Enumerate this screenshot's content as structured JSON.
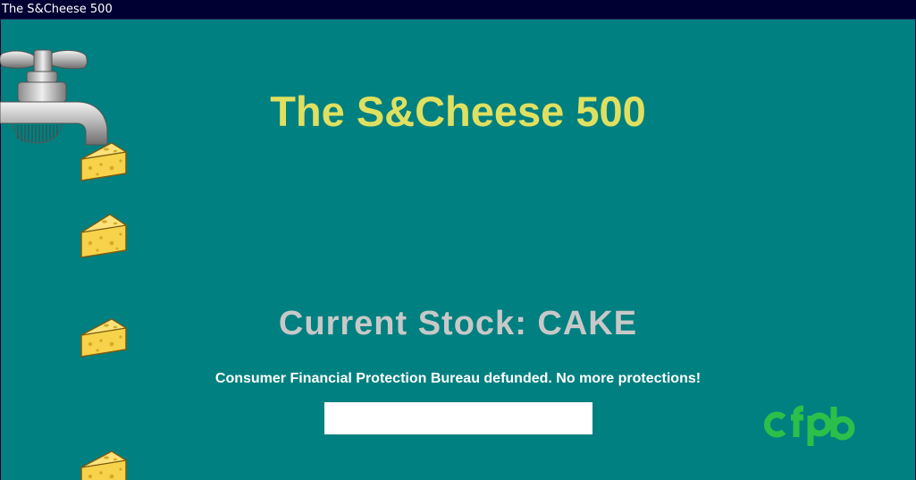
{
  "window": {
    "title": "The S&Cheese 500"
  },
  "game": {
    "title": "The S&Cheese 500",
    "current_stock_label": "Current Stock: CAKE",
    "news_message": "Consumer Financial Protection Bureau defunded. No more protections!",
    "answer_input": {
      "value": "",
      "placeholder": ""
    }
  },
  "logo": {
    "text": "cfpb",
    "color": "#2cbf4a"
  },
  "colors": {
    "background": "#008080",
    "title": "#e0e060",
    "stock": "#c8c8c8",
    "news": "#ffffff",
    "titlebar": "#000032"
  },
  "sprites": {
    "faucet": "faucet-icon",
    "cheese": "cheese-icon",
    "cheese_count": 4
  }
}
